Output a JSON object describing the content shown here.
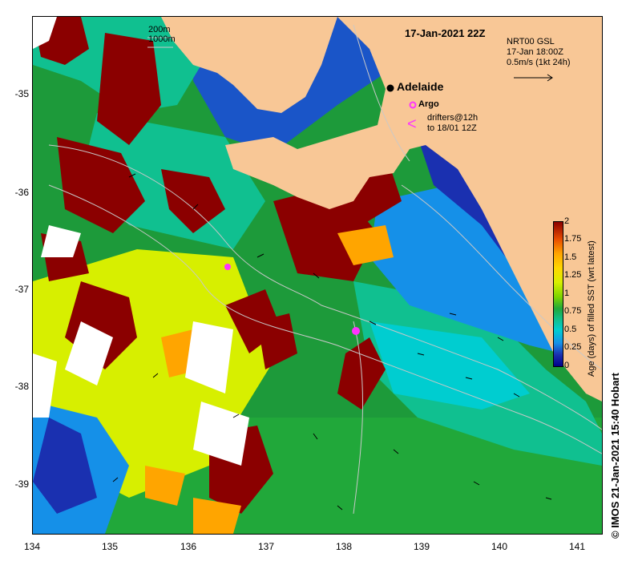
{
  "map": {
    "date": "17-Jan-2021 22Z",
    "legend_depth_1": "200m",
    "legend_depth_2": "1000m",
    "product": "NRT00 GSL",
    "product_time": "17-Jan 18:00Z",
    "velocity_scale": "0.5m/s (1kt 24h)",
    "city": "Adelaide",
    "argo_label": "Argo",
    "drifters_line1": "drifters@12h",
    "drifters_line2": "to 18/01 12Z",
    "drifter_symbol": "<",
    "credit": "© IMOS 21-Jan-2021 15:40 Hobart",
    "lon_ticks": [
      "134",
      "135",
      "136",
      "137",
      "138",
      "139",
      "140",
      "141"
    ],
    "lat_ticks": [
      "-35",
      "-36",
      "-37",
      "-38",
      "-39"
    ],
    "colorbar": {
      "title": "Age (days) of filled SST (wrt latest)",
      "ticks": [
        "2",
        "1.75",
        "1.5",
        "1.25",
        "1",
        "0.75",
        "0.5",
        "0.25",
        "0"
      ],
      "range": [
        0,
        2
      ],
      "colors": [
        "#00008b",
        "#1a30b0",
        "#1590e8",
        "#00cdd0",
        "#10c090",
        "#21a83a",
        "#7dd400",
        "#d7ef00",
        "#ffd700",
        "#ffa500",
        "#e84d00",
        "#8b0000"
      ]
    },
    "colors": {
      "land": "#f8c796",
      "ocean_green": "#1d9a3a",
      "stale_red": "#8b0000",
      "recent_blue": "#1a55c8",
      "argo_magenta": "#ff33ff"
    }
  }
}
